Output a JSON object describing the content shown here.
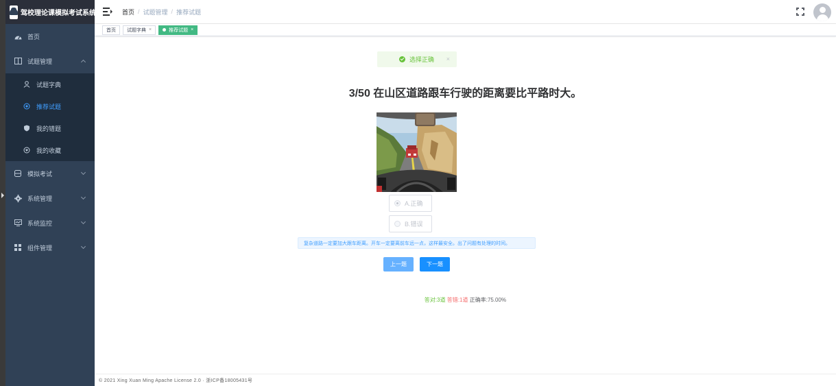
{
  "app": {
    "title": "驾校理论课模拟考试系统"
  },
  "sidebar": {
    "items": [
      {
        "label": "首页",
        "icon": "dashboard-icon"
      },
      {
        "label": "试题管理",
        "icon": "book-icon",
        "expanded": true,
        "children": [
          {
            "label": "试题字典",
            "icon": "user-icon",
            "active": false
          },
          {
            "label": "推荐试题",
            "icon": "target-icon",
            "active": true
          },
          {
            "label": "我的错题",
            "icon": "shield-icon",
            "active": false
          },
          {
            "label": "我的收藏",
            "icon": "heart-icon",
            "active": false
          }
        ]
      },
      {
        "label": "模拟考试",
        "icon": "database-icon"
      },
      {
        "label": "系统管理",
        "icon": "gear-icon"
      },
      {
        "label": "系统监控",
        "icon": "monitor-icon"
      },
      {
        "label": "组件管理",
        "icon": "grid-icon"
      }
    ]
  },
  "breadcrumb": [
    "首页",
    "试题管理",
    "推荐试题"
  ],
  "tags": [
    {
      "label": "首页",
      "active": false,
      "closable": false
    },
    {
      "label": "试题字典",
      "active": false,
      "closable": true
    },
    {
      "label": "推荐试题",
      "active": true,
      "closable": true
    }
  ],
  "alert": {
    "text": "选择正确",
    "type": "success"
  },
  "question": {
    "text": "3/50 在山区道路跟车行驶的距离要比平路时大。"
  },
  "options": [
    {
      "label": "A.正确",
      "checked": true
    },
    {
      "label": "B.错误",
      "checked": false
    }
  ],
  "explanation": "复杂道路一定要加大跟车距离。开车一定要离前车远一点，这样最安全。出了问题有处理的时间。",
  "buttons": {
    "prev": "上一题",
    "next": "下一题"
  },
  "stats": {
    "right": "答对:3道",
    "wrong": "答错:1道",
    "rate": "正确率:75.00%"
  },
  "footer": "© 2021 Xing Xuan Ming Apache License 2.0 · 浙ICP备18005431号",
  "colors": {
    "sidebar": "#304156",
    "accent": "#409eff",
    "success": "#67c23a",
    "danger": "#f56c6c",
    "tagActive": "#42b983"
  }
}
